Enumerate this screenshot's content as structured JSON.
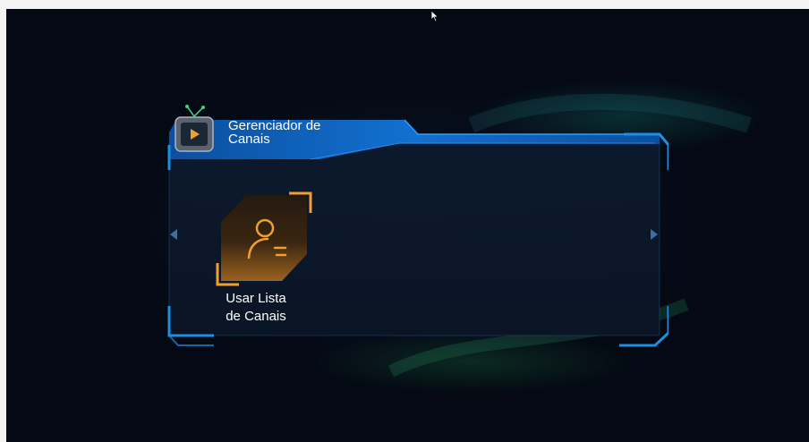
{
  "panel": {
    "title_line1": "Gerenciador de",
    "title_line2": "Canais"
  },
  "menu": {
    "items": [
      {
        "label_line1": "Usar Lista",
        "label_line2": "de Canais",
        "icon": "user-list-icon",
        "selected": true
      }
    ]
  },
  "colors": {
    "accent_blue": "#1c8fe0",
    "header_blue": "#0f5cb0",
    "selection_orange": "#f0a030",
    "background": "#040913"
  }
}
